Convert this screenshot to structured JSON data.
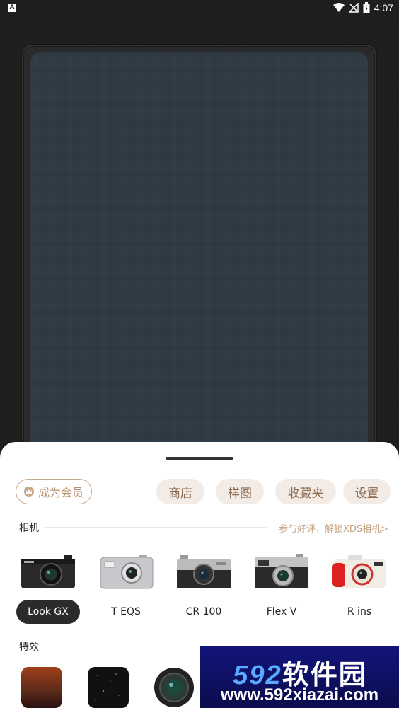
{
  "status_bar": {
    "left_icon": "A",
    "time": "4:07",
    "icons": [
      "wifi-icon",
      "signal-icon",
      "battery-icon"
    ]
  },
  "sheet": {
    "member_button": "成为会员",
    "pills": [
      "商店",
      "样图",
      "收藏夹",
      "设置"
    ],
    "camera_section": {
      "title": "相机",
      "link": "参与好评，解锁XDS相机>"
    },
    "cameras": [
      {
        "label": "Look GX",
        "selected": true
      },
      {
        "label": "T EQS",
        "selected": false
      },
      {
        "label": "CR 100",
        "selected": false
      },
      {
        "label": "Flex V",
        "selected": false
      },
      {
        "label": "R ins",
        "selected": false
      }
    ],
    "effects_section": {
      "title": "特效"
    }
  },
  "watermark": {
    "title_num": "592",
    "title_cn": "软件园",
    "url": "www.592xiazai.com"
  },
  "colors": {
    "accent": "#c8a88a",
    "pill_bg": "#f3ece6",
    "pill_text": "#8a6a50",
    "selected_bg": "#2b2b2b",
    "watermark_bg": "#0d0f5e"
  }
}
